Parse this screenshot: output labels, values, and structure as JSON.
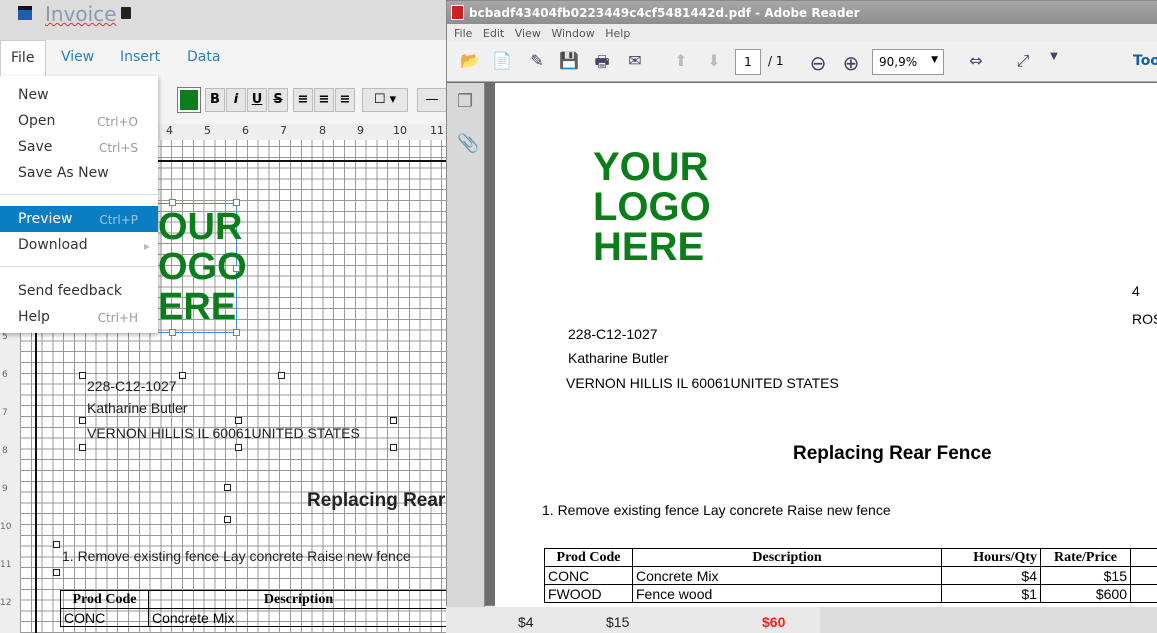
{
  "app": {
    "title": "Invoice",
    "icons": [
      "shredder-icon",
      "trash-icon"
    ]
  },
  "menu": {
    "tabs": [
      "File",
      "View",
      "Insert",
      "Data"
    ]
  },
  "toolbar": {
    "bold": "B",
    "italic": "i",
    "underline": "U",
    "strike": "S",
    "fill_color": "#0b7d1b"
  },
  "ruler": [
    "4",
    "5",
    "6",
    "7",
    "8",
    "9",
    "10",
    "11"
  ],
  "vruler": [
    "5",
    "6",
    "7",
    "8",
    "9",
    "10",
    "11",
    "12"
  ],
  "file_menu": [
    {
      "label": "New",
      "shortcut": ""
    },
    {
      "label": "Open",
      "shortcut": "Ctrl+O"
    },
    {
      "label": "Save",
      "shortcut": "Ctrl+S"
    },
    {
      "label": "Save As New",
      "shortcut": ""
    },
    {
      "label": "Preview",
      "shortcut": "Ctrl+P",
      "selected": true
    },
    {
      "label": "Download",
      "shortcut": "",
      "submenu": true
    },
    {
      "label": "Send feedback",
      "shortcut": ""
    },
    {
      "label": "Help",
      "shortcut": "Ctrl+H"
    }
  ],
  "invoice": {
    "logo": [
      "YOUR",
      "LOGO",
      "HERE"
    ],
    "logo_partial": [
      "OUR",
      "OGO",
      "ERE"
    ],
    "code": "228-C12-1027",
    "name": "Katharine Butler",
    "address": "VERNON HILLIS IL 60061UNITED STATES",
    "title": "Replacing Rear Fence",
    "title_partial": "Replacing Rear",
    "note": "1. Remove existing fence Lay concrete Raise new fence",
    "headers": [
      "Prod Code",
      "Description",
      "Hours/Qty",
      "Rate/Price"
    ],
    "rows": [
      [
        "CONC",
        "Concrete Mix",
        "$4",
        "$15",
        "$60"
      ],
      [
        "FWOOD",
        "Fence wood",
        "$1",
        "$600"
      ]
    ],
    "right_clip": "ROS",
    "right_clip2": "4"
  },
  "pdf": {
    "title": "bcbadf43404fb0223449c4cf5481442d.pdf - Adobe Reader",
    "menu": [
      "File",
      "Edit",
      "View",
      "Window",
      "Help"
    ],
    "page": "1",
    "pages": "/ 1",
    "zoom": "90,9%",
    "tools": "Too"
  }
}
